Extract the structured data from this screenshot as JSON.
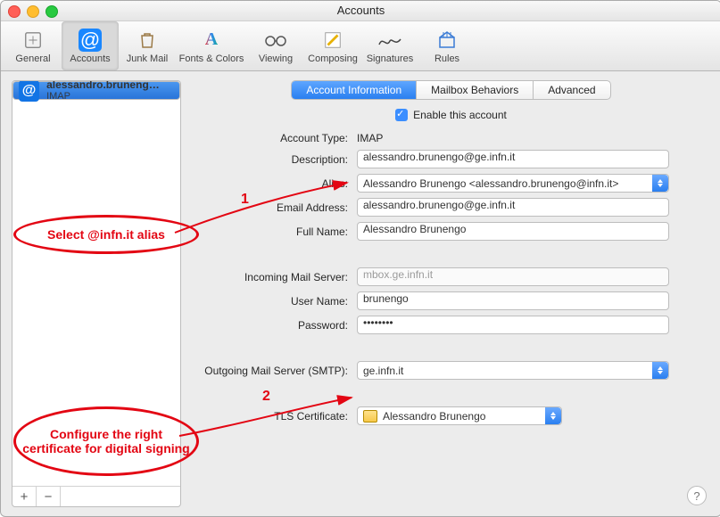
{
  "window": {
    "title": "Accounts"
  },
  "toolbar": {
    "general": "General",
    "accounts": "Accounts",
    "junk": "Junk Mail",
    "fonts": "Fonts & Colors",
    "viewing": "Viewing",
    "composing": "Composing",
    "signatures": "Signatures",
    "rules": "Rules"
  },
  "sidebar": {
    "items": [
      {
        "title": "alessandro.brunengo...",
        "subtitle": "IMAP"
      }
    ],
    "add": "+",
    "remove": "−"
  },
  "tabs": {
    "info": "Account Information",
    "mailbox": "Mailbox Behaviors",
    "advanced": "Advanced"
  },
  "enable": {
    "label": "Enable this account",
    "checked": true
  },
  "fields": {
    "account_type_label": "Account Type:",
    "account_type_value": "IMAP",
    "description_label": "Description:",
    "description_value": "alessandro.brunengo@ge.infn.it",
    "alias_label": "Alias:",
    "alias_value": "Alessandro Brunengo <alessandro.brunengo@infn.it>",
    "email_label": "Email Address:",
    "email_value": "alessandro.brunengo@ge.infn.it",
    "fullname_label": "Full Name:",
    "fullname_value": "Alessandro Brunengo",
    "incoming_label": "Incoming Mail Server:",
    "incoming_value": "mbox.ge.infn.it",
    "username_label": "User Name:",
    "username_value": "brunengo",
    "password_label": "Password:",
    "password_value": "••••••••",
    "smtp_label": "Outgoing Mail Server (SMTP):",
    "smtp_value": "ge.infn.it",
    "tls_label": "TLS Certificate:",
    "tls_value": "Alessandro Brunengo"
  },
  "annotations": {
    "n1": "1",
    "n2": "2",
    "t1": "Select @infn.it alias",
    "t2": "Configure the right certificate for digital signing"
  },
  "help": "?"
}
